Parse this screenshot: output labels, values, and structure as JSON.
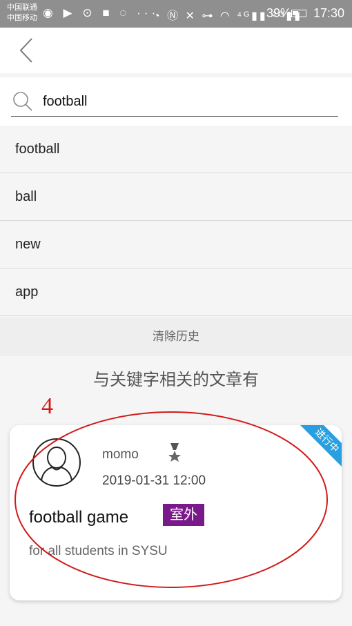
{
  "status_bar": {
    "carrier_line1": "中国联通",
    "carrier_line2": "中国移动",
    "left_icons": "◉ ▶ ⊙ ■ ◌ ···",
    "right_icons": "◔ Ⓝ ✕ ⊶ ◠ ⁴ᴳ▮▮ ²ᴳ▮▮",
    "battery": "39%",
    "time": "17:30"
  },
  "search": {
    "value": "football",
    "placeholder": ""
  },
  "history": {
    "items": [
      "football",
      "ball",
      "new",
      "app"
    ],
    "clear_label": "清除历史"
  },
  "related": {
    "heading": "与关键字相关的文章有"
  },
  "annotation": {
    "number": "4",
    "color": "#d21a1a"
  },
  "article": {
    "author": "momo",
    "date": "2019-01-31 12:00",
    "title": "football game",
    "tag": "室外",
    "description": "for all students in SYSU",
    "status_ribbon": "进行中",
    "colors": {
      "tag": "#7a1a8a",
      "ribbon": "#2a9fe0"
    }
  }
}
